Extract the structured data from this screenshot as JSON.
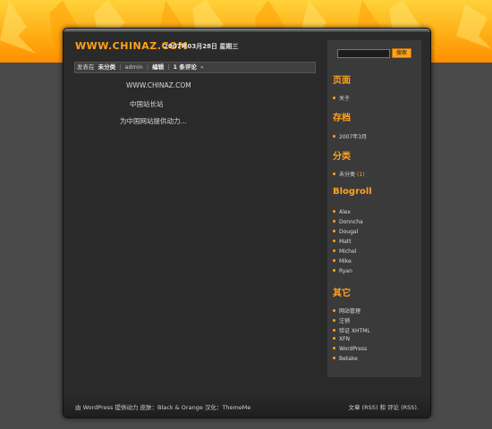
{
  "header": {
    "site_title": "WWW.CHINAZ.COM",
    "date": "2007年03月28日  星期三"
  },
  "post_meta": {
    "posted_in": "发表在",
    "category": "未分类",
    "author": "admin",
    "edit": "编辑",
    "comments": "1 条评论",
    "arrow": "»"
  },
  "content": {
    "lines": [
      "WWW.CHINAZ.COM",
      "中国站长站",
      "为中国网站提供动力…"
    ]
  },
  "sidebar": {
    "search_placeholder": "",
    "search_button": "搜索",
    "pages_title": "页面",
    "pages": [
      "关于"
    ],
    "archives_title": "存档",
    "archives": [
      "2007年3月"
    ],
    "categories_title": "分类",
    "categories": [
      {
        "name": "未分类",
        "count": "(1)"
      }
    ],
    "blogroll_title": "Blogroll",
    "blogroll": [
      "Alex",
      "Donncha",
      "Dougal",
      "Matt",
      "Michel",
      "Mike",
      "Ryan"
    ],
    "meta_title": "其它",
    "meta": [
      "网站管理",
      "注销",
      "验证 XHTML",
      "XFN",
      "WordPress",
      "Betake"
    ]
  },
  "footer": {
    "left": "由 WordPress 提供动力  皮肤：Black & Orange 汉化：ThemeMe",
    "right": "文章 (RSS) 和 评论 (RSS)."
  },
  "colors": {
    "accent": "#ffa21c",
    "background": "#4a4a4a",
    "panel": "#2a2a2a",
    "sidebar": "#3a3a3a"
  }
}
